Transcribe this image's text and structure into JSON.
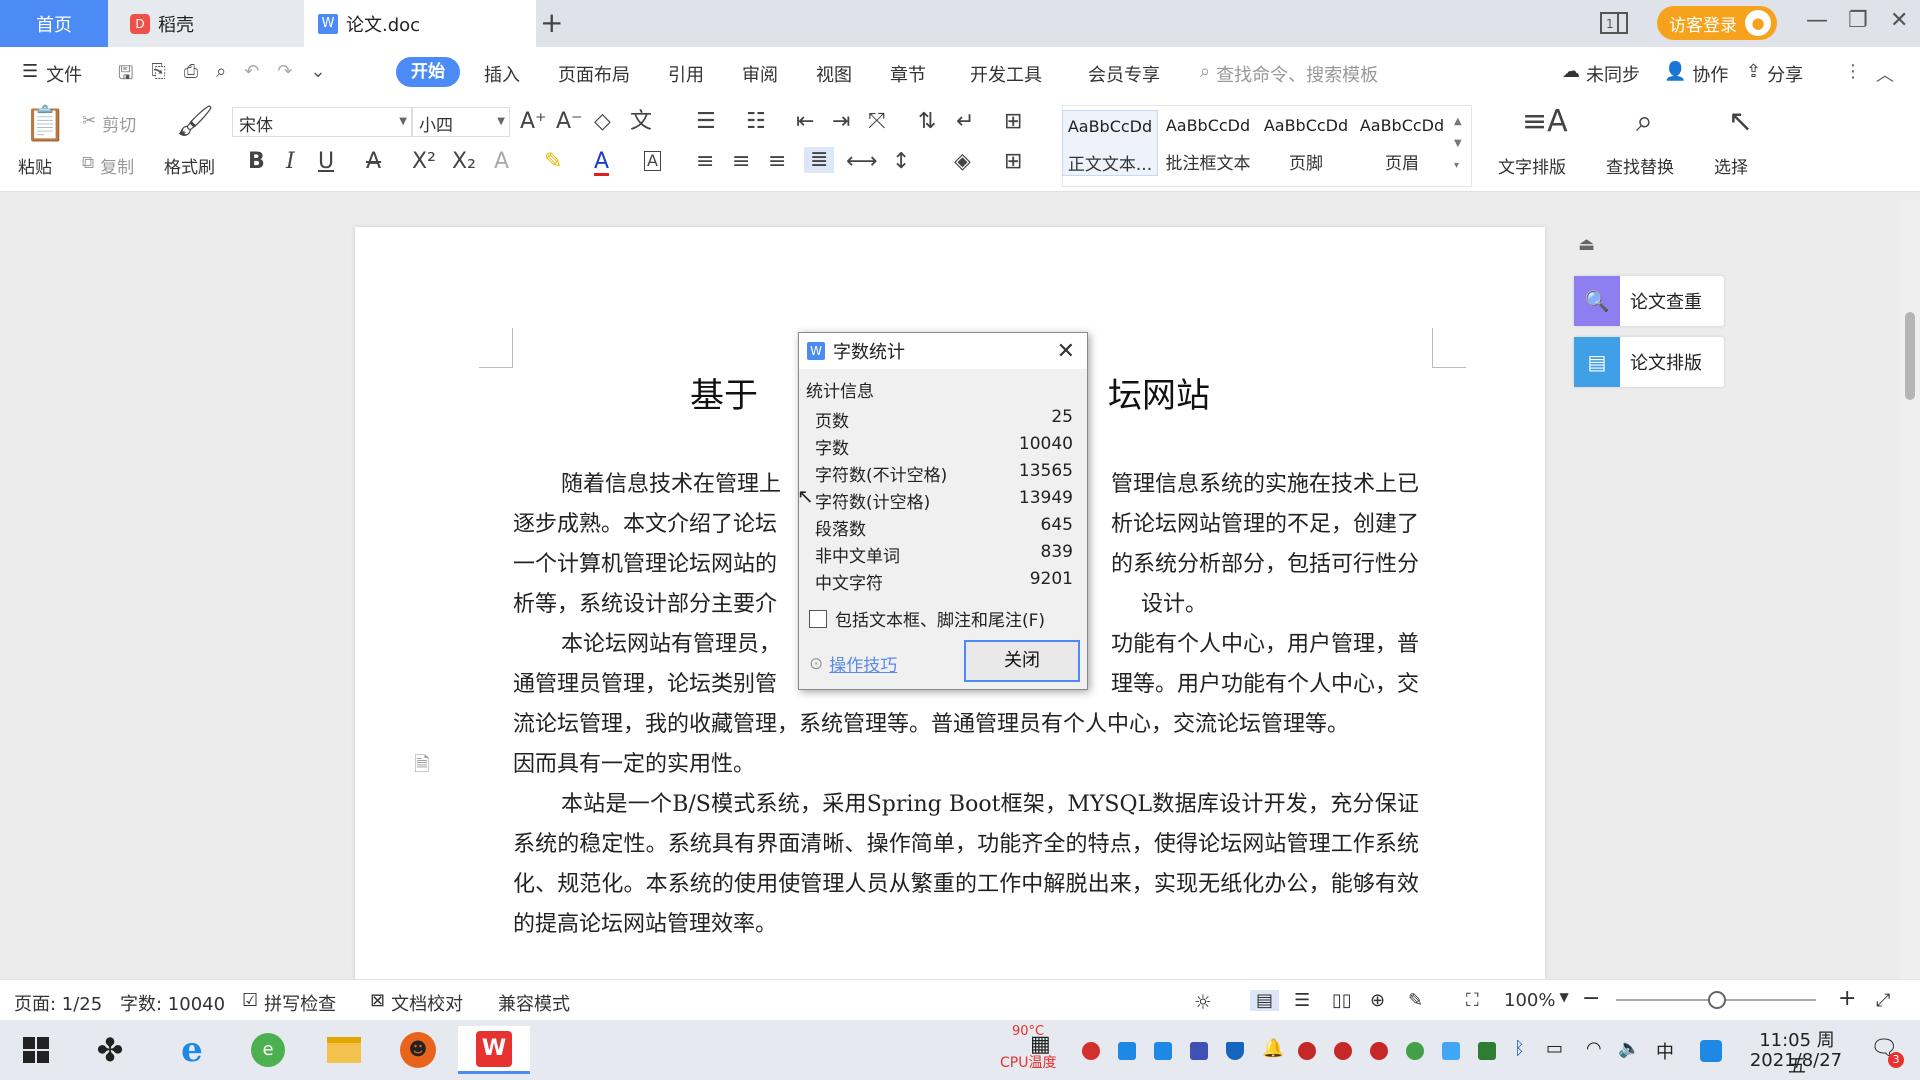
{
  "tabs": {
    "home": "首页",
    "daoke": "稻壳",
    "doc": "论文.doc"
  },
  "titlebar": {
    "visitor_label": "访客登录"
  },
  "menu": {
    "file": "文件",
    "items": [
      "开始",
      "插入",
      "页面布局",
      "引用",
      "审阅",
      "视图",
      "章节",
      "开发工具",
      "会员专享"
    ],
    "search_placeholder": "查找命令、搜索模板",
    "sync": "未同步",
    "collab": "协作",
    "share": "分享"
  },
  "ribbon": {
    "paste": "粘贴",
    "cut": "剪切",
    "copy": "复制",
    "format_painter": "格式刷",
    "font_name": "宋体",
    "font_size": "小四",
    "styles": [
      {
        "sample": "AaBbCcDd",
        "name": "正文文本..."
      },
      {
        "sample": "AaBbCcDd",
        "name": "批注框文本"
      },
      {
        "sample": "AaBbCcDd",
        "name": "页脚"
      },
      {
        "sample": "AaBbCcDd",
        "name": "页眉"
      }
    ],
    "text_layout": "文字排版",
    "find_replace": "查找替换",
    "select": "选择"
  },
  "document": {
    "title_left": "基于",
    "title_right": "坛网站",
    "p1_l1a": "随着信息技术在管理上",
    "p1_l1b": "管理信息系统的实施在技术上已",
    "p1_l2a": "逐步成熟。本文介绍了论坛",
    "p1_l2b": "析论坛网站管理的不足，创建了",
    "p1_l3a": "一个计算机管理论坛网站的",
    "p1_l3b": "的系统分析部分，包括可行性分",
    "p1_l4a": "析等，系统设计部分主要介",
    "p1_l4b": "设计。",
    "p2_l1a": "本论坛网站有管理员，",
    "p2_l1b": "功能有个人中心，用户管理，普",
    "p2_l2a": "通管理员管理，论坛类别管",
    "p2_l2b": "理等。用户功能有个人中心，交",
    "p2_l3": "流论坛管理，我的收藏管理，系统管理等。普通管理员有个人中心，交流论坛管理等。",
    "p2_l4": "因而具有一定的实用性。",
    "p3": "本站是一个B/S模式系统，采用Spring Boot框架，MYSQL数据库设计开发，充分保证系统的稳定性。系统具有界面清晰、操作简单，功能齐全的特点，使得论坛网站管理工作系统化、规范化。本系统的使用使管理人员从繁重的工作中解脱出来，实现无纸化办公，能够有效的提高论坛网站管理效率。"
  },
  "side_panel": {
    "plagiarism": "论文查重",
    "layout": "论文排版"
  },
  "dialog": {
    "title": "字数统计",
    "section": "统计信息",
    "stats": [
      {
        "label": "页数",
        "value": "25"
      },
      {
        "label": "字数",
        "value": "10040"
      },
      {
        "label": "字符数(不计空格)",
        "value": "13565"
      },
      {
        "label": "字符数(计空格)",
        "value": "13949"
      },
      {
        "label": "段落数",
        "value": "645"
      },
      {
        "label": "非中文单词",
        "value": "839"
      },
      {
        "label": "中文字符",
        "value": "9201"
      }
    ],
    "include_label": "包括文本框、脚注和尾注(F)",
    "tips": "操作技巧",
    "close": "关闭"
  },
  "status": {
    "page": "页面: 1/25",
    "words": "字数: 10040",
    "spell": "拼写检查",
    "proof": "文档校对",
    "compat": "兼容模式",
    "zoom": "100%"
  },
  "taskbar": {
    "cpu_temp": "90°C",
    "cpu_label": "CPU温度",
    "ime": "中",
    "time": "11:05 周五",
    "date": "2021/8/27",
    "notif_count": "3"
  },
  "colors": {
    "accent": "#4c8bf5",
    "visitor": "#f7a21c",
    "wps_red": "#e8322f"
  }
}
